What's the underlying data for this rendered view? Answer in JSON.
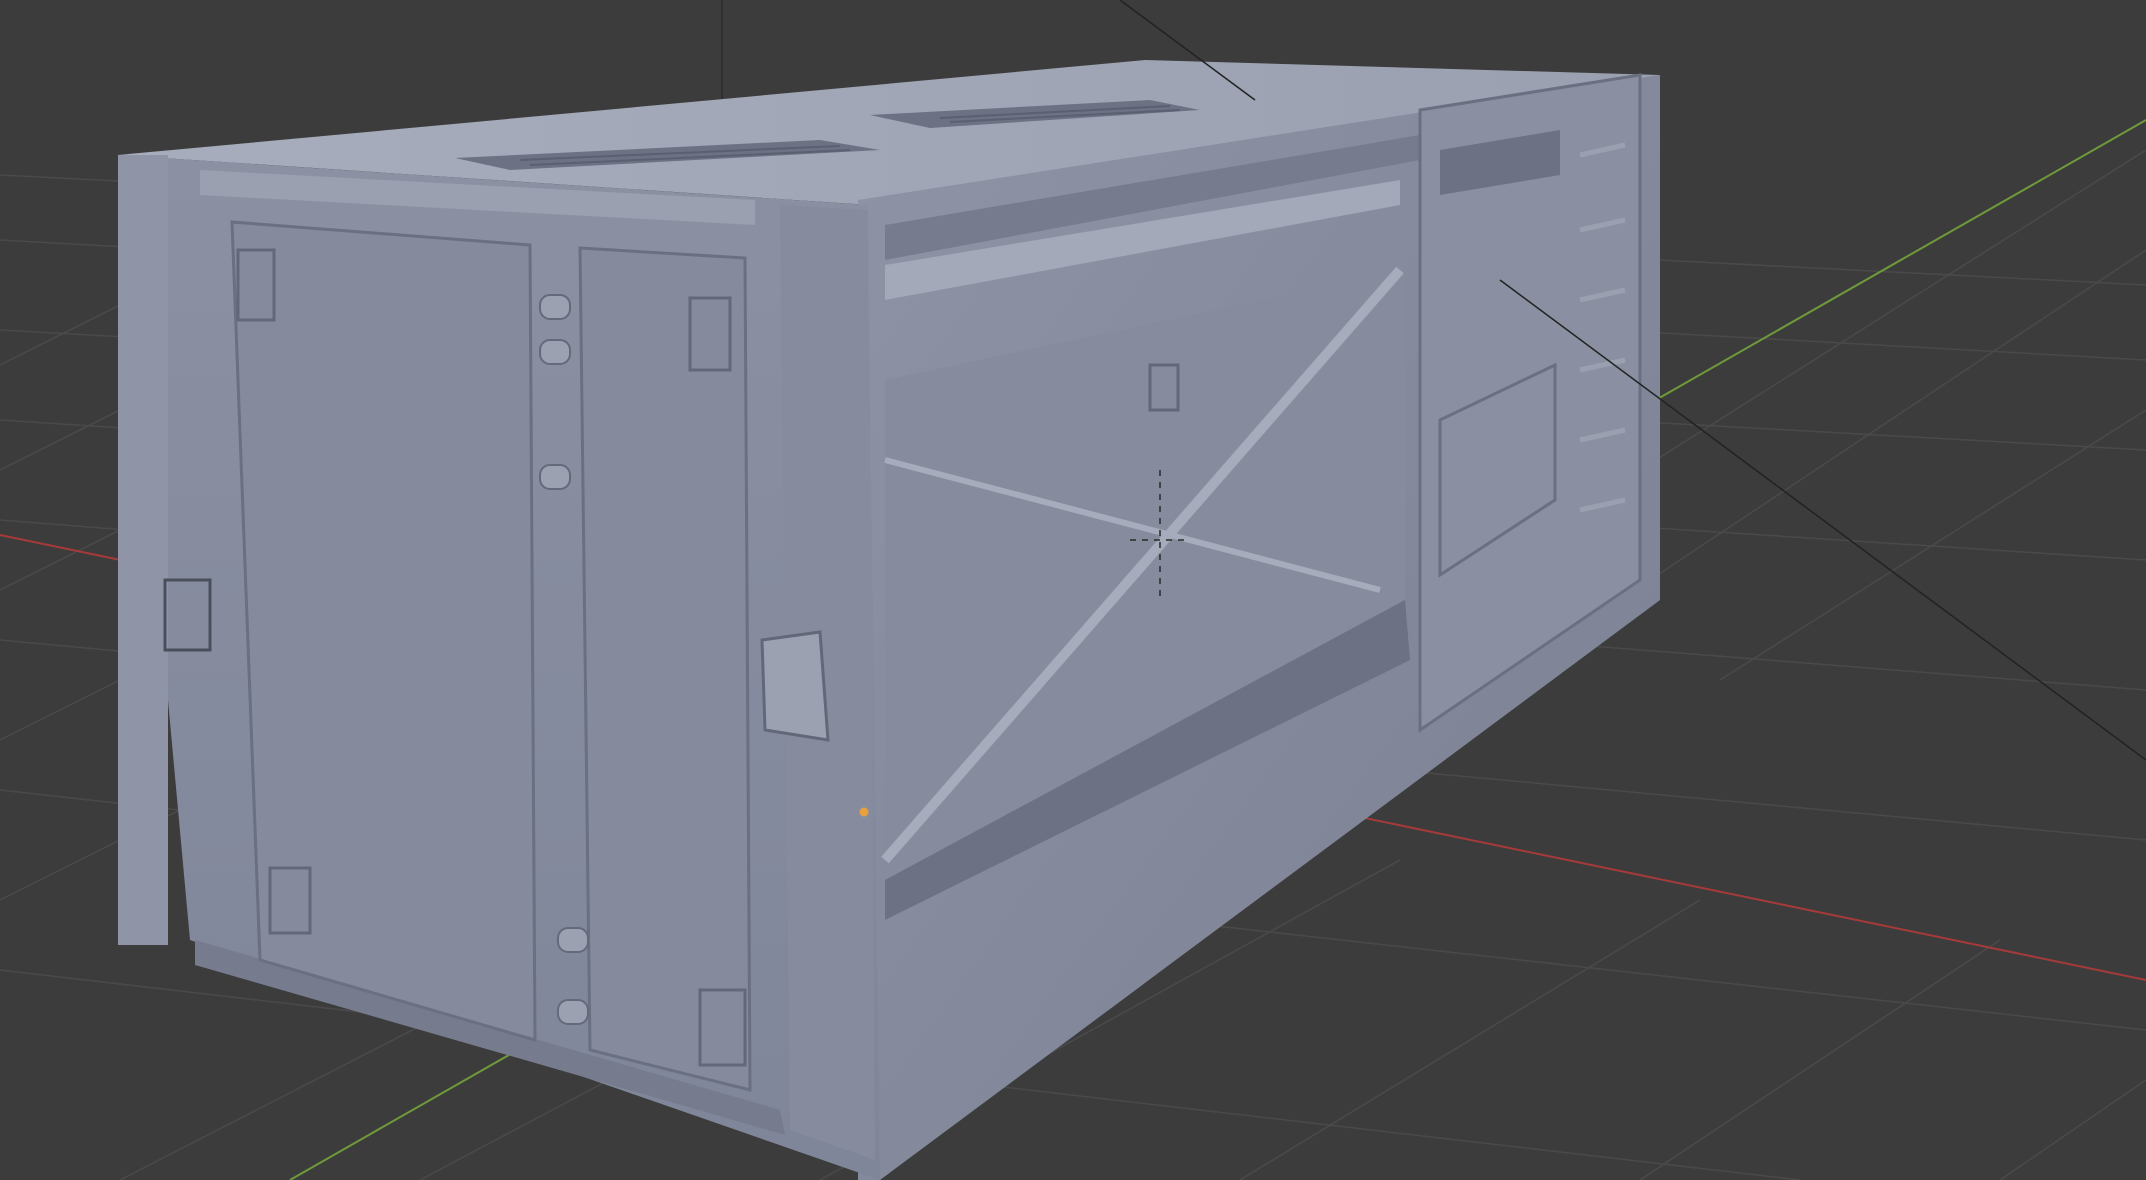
{
  "viewport": {
    "background": "#3c3c3c",
    "grid_color": "#4a4a4a",
    "x_axis_color": "#a63a3a",
    "y_axis_color": "#6f9a3a",
    "z_axis_color": "#2a2a2a",
    "model_base_color": "#8c92a3",
    "model_light_color": "#a2a8b8",
    "model_shadow_color": "#6c7283",
    "origin_color": "#e8a040"
  },
  "scene": {
    "object": "container-3d-model",
    "shading": "solid",
    "icons": [
      "3d-cursor-icon",
      "object-origin-icon"
    ]
  }
}
